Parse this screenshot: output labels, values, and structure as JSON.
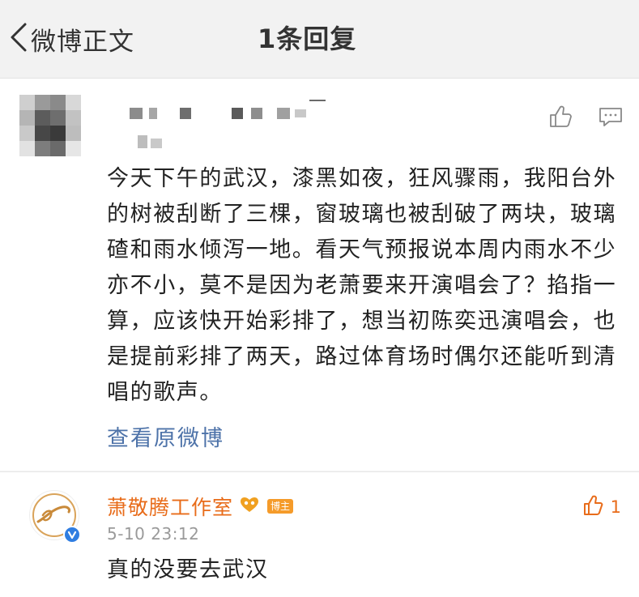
{
  "header": {
    "back_label": "微博正文",
    "title": "1条回复"
  },
  "post": {
    "text": "今天下午的武汉，漆黑如夜，狂风骤雨，我阳台外的树被刮断了三棵，窗玻璃也被刮破了两块，玻璃碴和雨水倾泻一地。看天气预报说本周内雨水不少亦不小，莫不是因为老萧要来开演唱会了？掐指一算，应该快开始彩排了，想当初陈奕迅演唱会，也是提前彩排了两天，路过体育场时偶尔还能听到清唱的歌声。",
    "view_original": "查看原微博",
    "icons": [
      "like-icon",
      "comment-icon"
    ]
  },
  "reply": {
    "name": "萧敬腾工作室",
    "badge": "博主",
    "time": "5-10 23:12",
    "text": "真的没要去武汉",
    "like_count": "1"
  },
  "colors": {
    "accent_orange": "#e86c1a",
    "link_blue": "#4e73a9",
    "verified_blue": "#2f7de1",
    "page_bg": "#f2f2f2"
  }
}
